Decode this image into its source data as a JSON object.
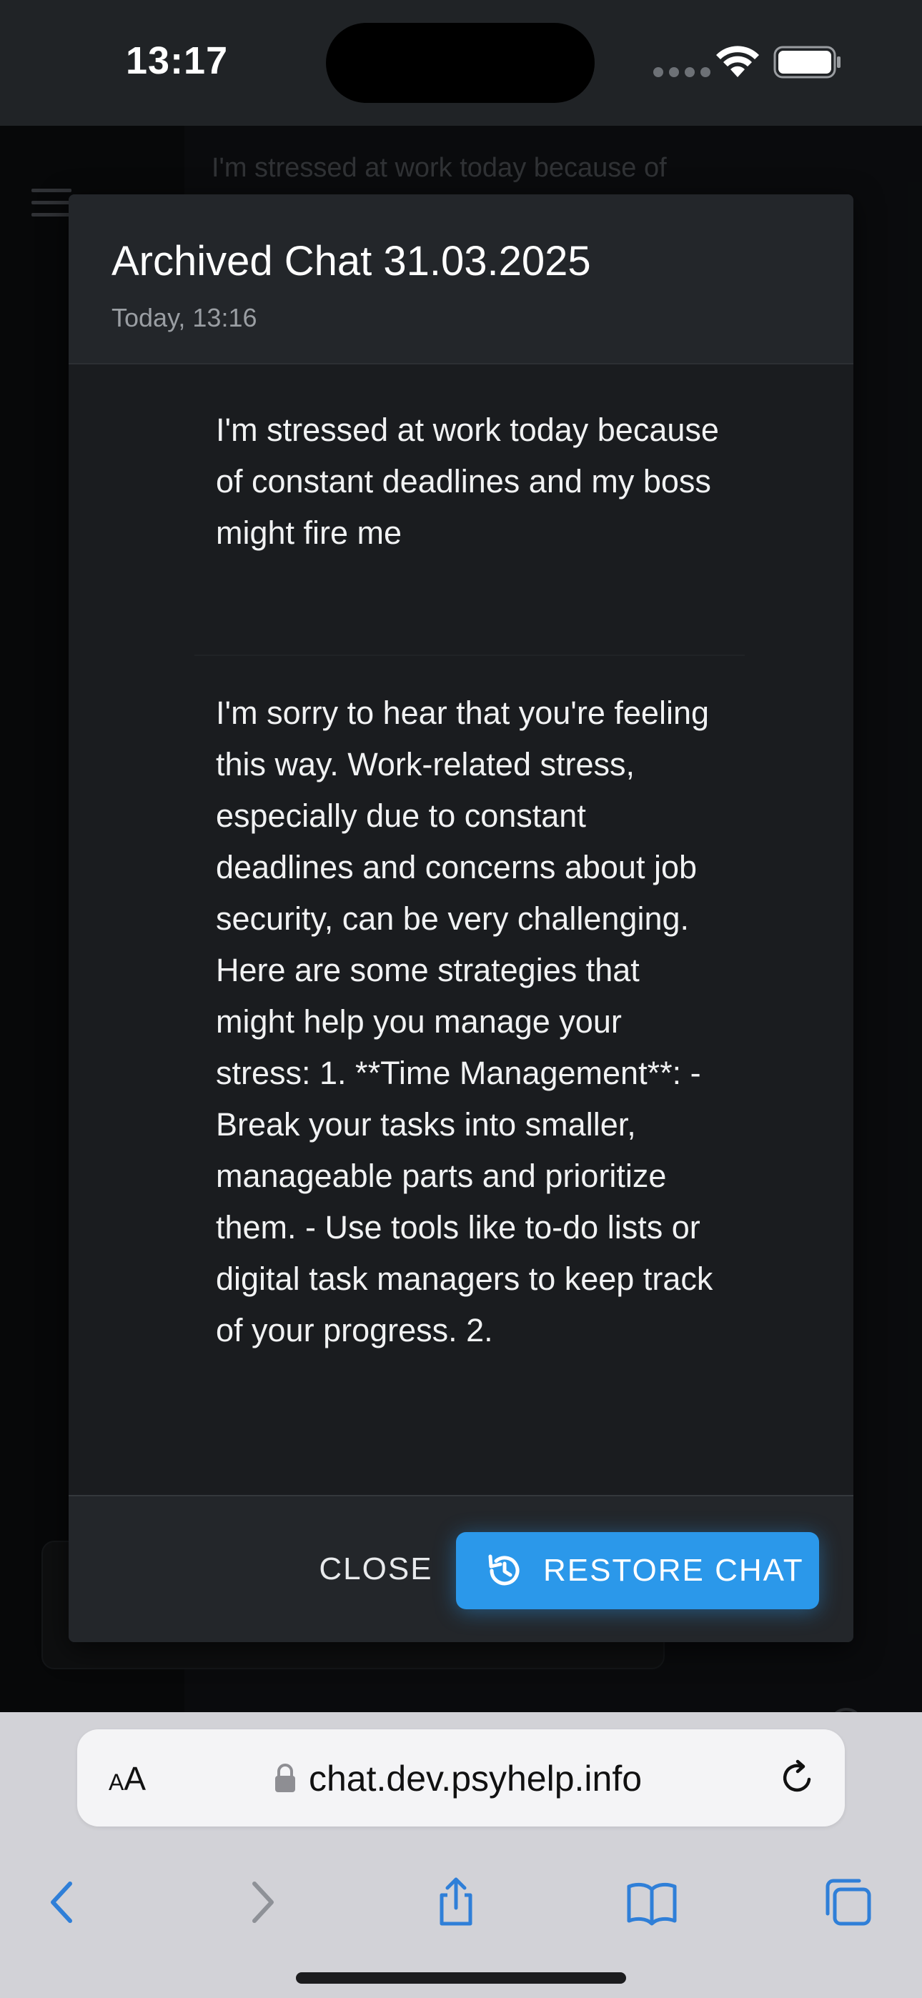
{
  "status_bar": {
    "time": "13:17"
  },
  "background": {
    "message_preview": "I'm stressed at work today because of"
  },
  "modal": {
    "title": "Archived Chat 31.03.2025",
    "subtitle": "Today, 13:16",
    "messages": [
      {
        "role": "user",
        "text": "I'm stressed at work today because of constant deadlines and my boss might fire me"
      },
      {
        "role": "assistant",
        "text": "I'm sorry to hear that you're feeling this way. Work-related stress, especially due to constant deadlines and concerns about job security, can be very challenging. Here are some strategies that might help you manage your stress: 1. **Time Management**: - Break your tasks into smaller, manageable parts and prioritize them. - Use tools like to-do lists or digital task managers to keep track of your progress. 2."
      }
    ],
    "close_label": "CLOSE",
    "restore_label": "RESTORE CHAT",
    "restore_icon": "history-restore-icon",
    "accent_color": "#2b98ea"
  },
  "browser": {
    "aa_small": "A",
    "aa_large": "A",
    "url": "chat.dev.psyhelp.info",
    "nav_icons": [
      "back-icon",
      "forward-icon",
      "share-icon",
      "bookmarks-icon",
      "tabs-icon"
    ],
    "tint_color": "#2f7fd8"
  }
}
